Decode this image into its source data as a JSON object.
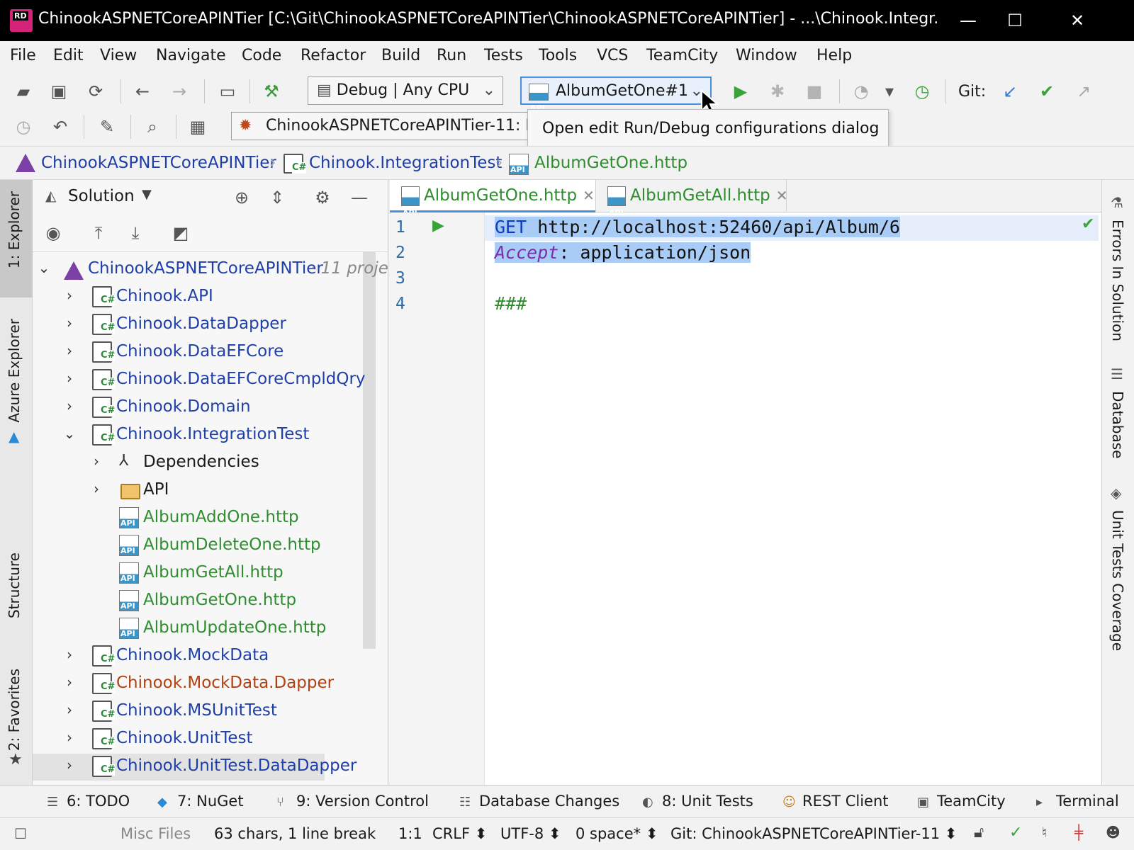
{
  "window": {
    "title": "ChinookASPNETCoreAPINTier [C:\\Git\\ChinookASPNETCoreAPINTier\\ChinookASPNETCoreAPINTier] - ...\\Chinook.Integr...",
    "minimize": "—",
    "maximize": "☐",
    "close": "✕"
  },
  "menu": [
    "File",
    "Edit",
    "View",
    "Navigate",
    "Code",
    "Refactor",
    "Build",
    "Run",
    "Tests",
    "Tools",
    "VCS",
    "TeamCity",
    "Window",
    "Help"
  ],
  "toolbar": {
    "config_combo": "Debug | Any CPU",
    "run_config_combo": "AlbumGetOne#1",
    "git_label": "Git:",
    "process_combo": "ChinookASPNETCoreAPINTier-11: I",
    "tooltip": "Open edit Run/Debug configurations dialog"
  },
  "breadcrumb": [
    "ChinookASPNETCoreAPINTier",
    "Chinook.IntegrationTest",
    "AlbumGetOne.http"
  ],
  "left_strip": [
    "1: Explorer",
    "Azure Explorer",
    "Structure",
    "2: Favorites"
  ],
  "right_strip": [
    "Errors In Solution",
    "Database",
    "Unit Tests Coverage"
  ],
  "explorer": {
    "title": "Solution",
    "solution_name": "ChinookASPNETCoreAPINTier",
    "solution_meta": "· 11 proje",
    "items": [
      {
        "label": "Chinook.API",
        "color": "blue"
      },
      {
        "label": "Chinook.DataDapper",
        "color": "blue"
      },
      {
        "label": "Chinook.DataEFCore",
        "color": "blue"
      },
      {
        "label": "Chinook.DataEFCoreCmpldQry",
        "color": "blue"
      },
      {
        "label": "Chinook.Domain",
        "color": "blue"
      },
      {
        "label": "Chinook.IntegrationTest",
        "color": "blue"
      },
      {
        "label": "Dependencies",
        "color": "black"
      },
      {
        "label": "API",
        "color": "black"
      },
      {
        "label": "AlbumAddOne.http",
        "color": "green"
      },
      {
        "label": "AlbumDeleteOne.http",
        "color": "green"
      },
      {
        "label": "AlbumGetAll.http",
        "color": "green"
      },
      {
        "label": "AlbumGetOne.http",
        "color": "green"
      },
      {
        "label": "AlbumUpdateOne.http",
        "color": "green"
      },
      {
        "label": "Chinook.MockData",
        "color": "blue"
      },
      {
        "label": "Chinook.MockData.Dapper",
        "color": "rust"
      },
      {
        "label": "Chinook.MSUnitTest",
        "color": "blue"
      },
      {
        "label": "Chinook.UnitTest",
        "color": "blue"
      },
      {
        "label": "Chinook.UnitTest.DataDapper",
        "color": "blue"
      }
    ]
  },
  "editor": {
    "tabs": [
      "AlbumGetOne.http",
      "AlbumGetAll.http"
    ],
    "line_numbers": [
      "1",
      "2",
      "3",
      "4"
    ],
    "lines": {
      "l1_method": "GET",
      "l1_url": " http://localhost:52460/api/Album/6",
      "l2_header": "Accept",
      "l2_value": ": application/json",
      "l4": "###"
    }
  },
  "bottom_tools": [
    {
      "label": "6: TODO",
      "icon": "list-icon"
    },
    {
      "label": "7: NuGet",
      "icon": "nuget-icon"
    },
    {
      "label": "9: Version Control",
      "icon": "branch-icon"
    },
    {
      "label": "Database Changes",
      "icon": "database-icon"
    },
    {
      "label": "8: Unit Tests",
      "icon": "unit-tests-icon"
    },
    {
      "label": "REST Client",
      "icon": "rest-client-icon"
    },
    {
      "label": "TeamCity",
      "icon": "teamcity-icon"
    },
    {
      "label": "Terminal",
      "icon": "terminal-icon"
    }
  ],
  "status": {
    "context": "Misc Files",
    "selection": "63 chars, 1 line break",
    "position": "1:1",
    "line_ending": "CRLF ⬍",
    "encoding": "UTF-8 ⬍",
    "indent": "0 space* ⬍",
    "git_branch": "Git: ChinookASPNETCoreAPINTier-11 ⬍"
  }
}
